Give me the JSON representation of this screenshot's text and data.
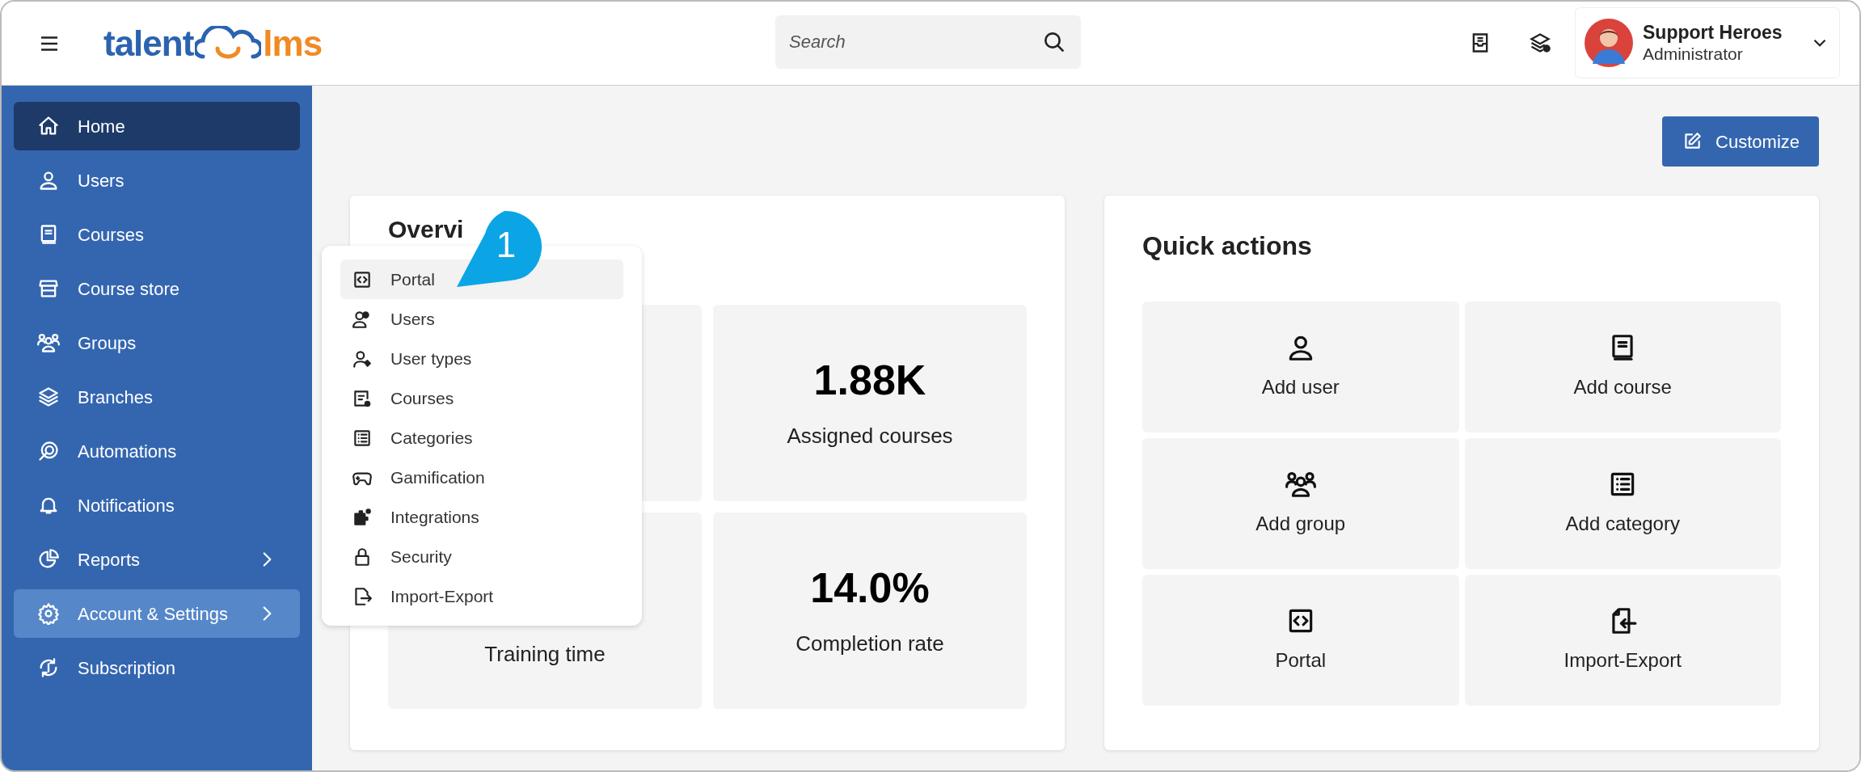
{
  "header": {
    "logo": {
      "parts": [
        "talent",
        "lms"
      ]
    },
    "search": {
      "placeholder": "Search"
    },
    "profile": {
      "name": "Support Heroes",
      "role": "Administrator"
    }
  },
  "sidebar": {
    "items": [
      {
        "label": "Home",
        "selected": true,
        "highlighted": false
      },
      {
        "label": "Users",
        "selected": false,
        "highlighted": false
      },
      {
        "label": "Courses",
        "selected": false,
        "highlighted": false
      },
      {
        "label": "Course store",
        "selected": false,
        "highlighted": false
      },
      {
        "label": "Groups",
        "selected": false,
        "highlighted": false
      },
      {
        "label": "Branches",
        "selected": false,
        "highlighted": false
      },
      {
        "label": "Automations",
        "selected": false,
        "highlighted": false
      },
      {
        "label": "Notifications",
        "selected": false,
        "highlighted": false
      },
      {
        "label": "Reports",
        "selected": false,
        "highlighted": false,
        "submenu": true
      },
      {
        "label": "Account & Settings",
        "selected": false,
        "highlighted": true,
        "submenu": true
      },
      {
        "label": "Subscription",
        "selected": false,
        "highlighted": false
      }
    ]
  },
  "customize_button": "Customize",
  "overview": {
    "title": "Overvi",
    "stats": [
      {
        "kind": "stat"
      },
      {
        "kind": "stat",
        "value": "1.88K",
        "label": "Assigned courses"
      },
      {
        "kind": "stat",
        "label": "Training time"
      },
      {
        "kind": "stat",
        "value": "14.0%",
        "label": "Completion rate"
      }
    ]
  },
  "quick_actions": {
    "title": "Quick actions",
    "items": [
      "Add user",
      "Add course",
      "Add group",
      "Add category",
      "Portal",
      "Import-Export"
    ]
  },
  "settings_menu": {
    "items": [
      {
        "label": "Portal",
        "selected": true
      },
      {
        "label": "Users",
        "selected": false
      },
      {
        "label": "User types",
        "selected": false
      },
      {
        "label": "Courses",
        "selected": false
      },
      {
        "label": "Categories",
        "selected": false
      },
      {
        "label": "Gamification",
        "selected": false
      },
      {
        "label": "Integrations",
        "selected": false
      },
      {
        "label": "Security",
        "selected": false
      },
      {
        "label": "Import-Export",
        "selected": false
      }
    ]
  },
  "callout": "1"
}
